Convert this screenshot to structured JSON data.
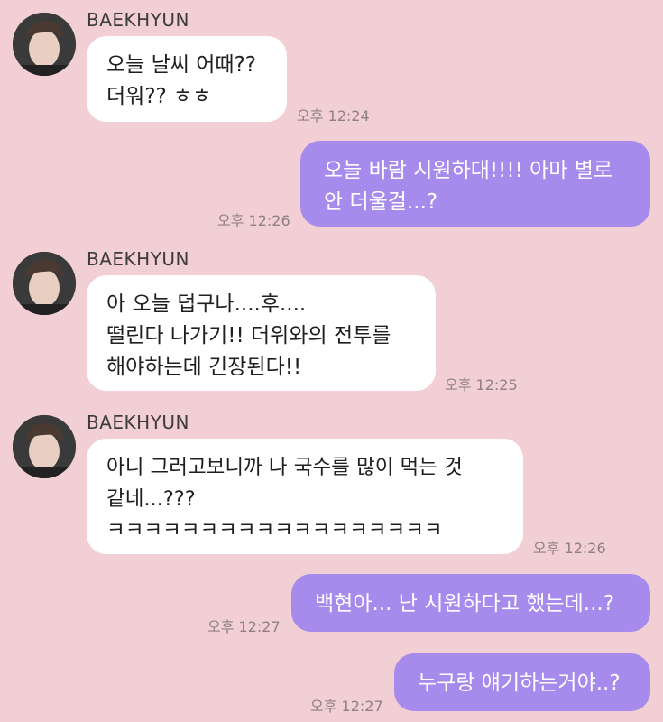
{
  "colors": {
    "background": "#f2cfd4",
    "incoming_bubble": "#ffffff",
    "outgoing_bubble": "#a68bec",
    "timestamp": "#8e8084"
  },
  "messages": [
    {
      "direction": "incoming",
      "sender": "BAEKHYUN",
      "avatar": "avatar-photo",
      "text": "오늘 날씨 어때??\n더워?? ㅎㅎ",
      "time": "오후 12:24"
    },
    {
      "direction": "outgoing",
      "text": "오늘 바람 시원하대!!!! 아마 별로\n안 더울걸...?",
      "time": "오후 12:26"
    },
    {
      "direction": "incoming",
      "sender": "BAEKHYUN",
      "avatar": "avatar-photo",
      "text": "아 오늘 덥구나....후....\n떨린다 나가기!! 더위와의 전투를\n해야하는데 긴장된다!!",
      "time": "오후 12:25"
    },
    {
      "direction": "incoming",
      "sender": "BAEKHYUN",
      "avatar": "avatar-photo",
      "text": "아니 그러고보니까 나 국수를 많이 먹는 것\n같네...???\nㅋㅋㅋㅋㅋㅋㅋㅋㅋㅋㅋㅋㅋㅋㅋㅋㅋㅋ",
      "time": "오후 12:26"
    },
    {
      "direction": "outgoing",
      "text": "백현아... 난 시원하다고 했는데...?",
      "time": "오후 12:27"
    },
    {
      "direction": "outgoing",
      "text": "누구랑 얘기하는거야..?",
      "time": "오후 12:27"
    }
  ]
}
